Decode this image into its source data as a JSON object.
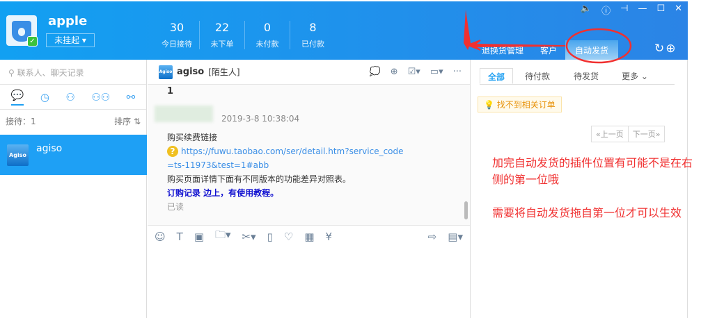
{
  "user": {
    "name": "apple",
    "status": "未挂起"
  },
  "stats": [
    {
      "value": "30",
      "label": "今日接待"
    },
    {
      "value": "22",
      "label": "未下单"
    },
    {
      "value": "0",
      "label": "未付款"
    },
    {
      "value": "8",
      "label": "已付款"
    }
  ],
  "plugin_tabs": [
    "退换货管理",
    "客户",
    "自动发货"
  ],
  "left": {
    "search_placeholder": "联系人、聊天记录",
    "queue": "接待：1",
    "sort": "排序 ⇅",
    "contact": "agiso",
    "contact_icon": "Agiso"
  },
  "chat": {
    "name": "agiso",
    "tag": "[陌生人]",
    "first": "1",
    "time": "2019-3-8 10:38:04",
    "lines": {
      "l1": "购买续费链接",
      "link1": "https://fuwu.taobao.com/ser/detail.htm?service_code",
      "link2": "=ts-11973&test=1#abb",
      "l3": "购买页面详情下面有不同版本的功能差异对照表。",
      "l4": "订购记录 边上，有使用教程。",
      "read": "已读"
    }
  },
  "right": {
    "tabs": [
      "全部",
      "待付款",
      "待发货",
      "更多 ⌄"
    ],
    "tip": "找不到相关订单",
    "prev": "«上一页",
    "next": "下一页»"
  },
  "annotation": {
    "line1": "加完自动发货的插件位置有可能不是在右侧的第一位哦",
    "line2": "需要将自动发货拖自第一位才可以生效"
  },
  "colors": {
    "header": "#1ea0f5",
    "annotation": "#f03030"
  }
}
